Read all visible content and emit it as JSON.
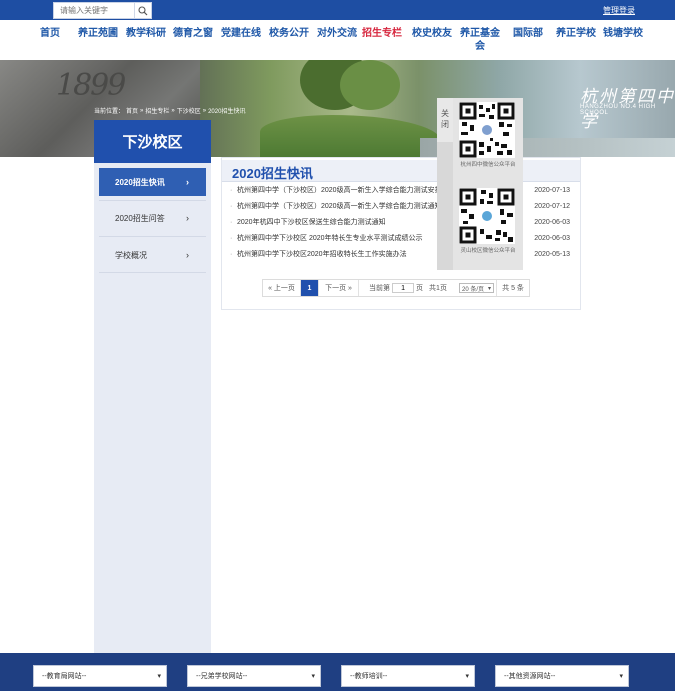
{
  "topbar": {
    "search_placeholder": "请输入关键字",
    "admin_login": "管理登录"
  },
  "nav": {
    "items": [
      "首页",
      "养正苑圃",
      "教学科研",
      "德育之窗",
      "党建在线",
      "校务公开",
      "对外交流",
      "招生专栏",
      "校史校友",
      "养正基金会",
      "国际部",
      "养正学校",
      "钱塘学校"
    ],
    "active_index": 7
  },
  "banner": {
    "year": "1899",
    "logo_cn": "杭州第四中学",
    "logo_en": "HANGZHOU NO.4 HIGH SCHOOL"
  },
  "breadcrumb": {
    "prefix": "当前位置：",
    "items": [
      "首页",
      "招生专栏",
      "下沙校区",
      "2020招生快讯"
    ],
    "sep": "»"
  },
  "sidebar": {
    "title": "下沙校区",
    "items": [
      {
        "label": "2020招生快讯",
        "active": true
      },
      {
        "label": "2020招生问答",
        "active": false
      },
      {
        "label": "学校概况",
        "active": false
      }
    ],
    "arrow": "›"
  },
  "content": {
    "title": "2020招生快讯",
    "bullet": "·",
    "news": [
      {
        "title": "杭州第四中学（下沙校区）2020级高一新生入学综合能力测试安排",
        "date": "2020-07-13"
      },
      {
        "title": "杭州第四中学（下沙校区）2020级高一新生入学综合能力测试通知",
        "date": "2020-07-12"
      },
      {
        "title": "2020年杭四中下沙校区保送生综合能力测试通知",
        "date": "2020-06-03"
      },
      {
        "title": "杭州第四中学下沙校区 2020年特长生专业水平测试成绩公示",
        "date": "2020-06-03"
      },
      {
        "title": "杭州第四中学下沙校区2020年招收特长生工作实施办法",
        "date": "2020-05-13"
      }
    ],
    "pager": {
      "prev": "« 上一页",
      "current": "1",
      "next": "下一页 »",
      "goto_label": "当前第",
      "goto_value": "1",
      "page_unit": "页",
      "total_pages": "共1页",
      "per_page": "20 条/页",
      "total_items": "共 5 条"
    }
  },
  "qr_panel": {
    "close_label": "关闭",
    "cards": [
      {
        "caption": "杭州四中微信公众平台"
      },
      {
        "caption": "灵山校区微信公众平台"
      }
    ]
  },
  "footer": {
    "selects": [
      "--教育局网站--",
      "--兄弟学校网站--",
      "--教师培训--",
      "--其他资源网站--"
    ]
  }
}
